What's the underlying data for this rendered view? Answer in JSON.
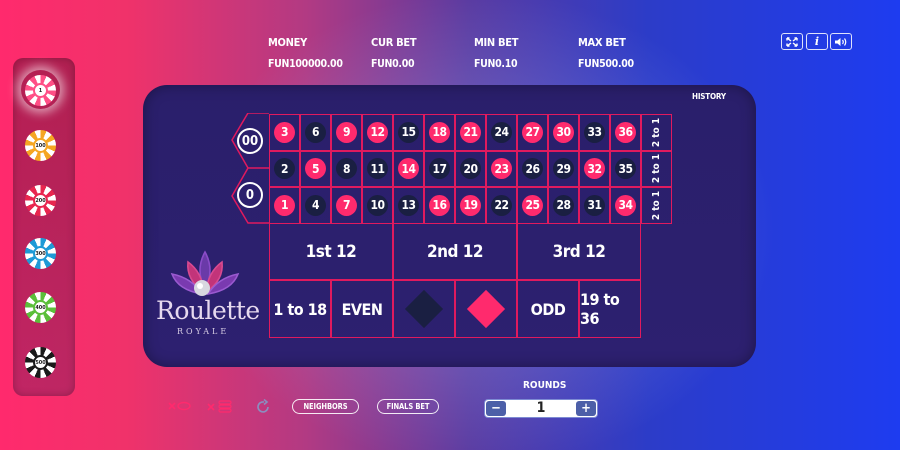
{
  "stats": [
    {
      "label": "MONEY",
      "value": "FUN100000.00"
    },
    {
      "label": "CUR BET",
      "value": "FUN0.00"
    },
    {
      "label": "MIN BET",
      "value": "FUN0.10"
    },
    {
      "label": "MAX BET",
      "value": "FUN500.00"
    }
  ],
  "top_buttons": {
    "fullscreen_icon": "fullscreen-icon",
    "info_label": "i",
    "sound_icon": "speaker-icon"
  },
  "chips": [
    {
      "value": "1",
      "color": "#ff4f86",
      "selected": true
    },
    {
      "value": "100",
      "color": "#f5a623"
    },
    {
      "value": "200",
      "color": "#e8264f"
    },
    {
      "value": "300",
      "color": "#1e9ad6"
    },
    {
      "value": "400",
      "color": "#5bbf3a"
    },
    {
      "value": "500",
      "color": "#1a1a1a"
    }
  ],
  "history_label": "HISTORY",
  "zeros": [
    "00",
    "0"
  ],
  "number_rows": [
    [
      {
        "n": "3",
        "c": "red"
      },
      {
        "n": "6",
        "c": "black"
      },
      {
        "n": "9",
        "c": "red"
      },
      {
        "n": "12",
        "c": "red"
      },
      {
        "n": "15",
        "c": "black"
      },
      {
        "n": "18",
        "c": "red"
      },
      {
        "n": "21",
        "c": "red"
      },
      {
        "n": "24",
        "c": "black"
      },
      {
        "n": "27",
        "c": "red"
      },
      {
        "n": "30",
        "c": "red"
      },
      {
        "n": "33",
        "c": "black"
      },
      {
        "n": "36",
        "c": "red"
      }
    ],
    [
      {
        "n": "2",
        "c": "black"
      },
      {
        "n": "5",
        "c": "red"
      },
      {
        "n": "8",
        "c": "black"
      },
      {
        "n": "11",
        "c": "black"
      },
      {
        "n": "14",
        "c": "red"
      },
      {
        "n": "17",
        "c": "black"
      },
      {
        "n": "20",
        "c": "black"
      },
      {
        "n": "23",
        "c": "red"
      },
      {
        "n": "26",
        "c": "black"
      },
      {
        "n": "29",
        "c": "black"
      },
      {
        "n": "32",
        "c": "red"
      },
      {
        "n": "35",
        "c": "black"
      }
    ],
    [
      {
        "n": "1",
        "c": "red"
      },
      {
        "n": "4",
        "c": "black"
      },
      {
        "n": "7",
        "c": "red"
      },
      {
        "n": "10",
        "c": "black"
      },
      {
        "n": "13",
        "c": "black"
      },
      {
        "n": "16",
        "c": "red"
      },
      {
        "n": "19",
        "c": "red"
      },
      {
        "n": "22",
        "c": "black"
      },
      {
        "n": "25",
        "c": "red"
      },
      {
        "n": "28",
        "c": "black"
      },
      {
        "n": "31",
        "c": "black"
      },
      {
        "n": "34",
        "c": "red"
      }
    ]
  ],
  "columns": [
    "2 to 1",
    "2 to 1",
    "2 to 1"
  ],
  "dozens": [
    "1st 12",
    "2nd 12",
    "3rd 12"
  ],
  "outside": {
    "low": "1 to 18",
    "even": "EVEN",
    "odd": "ODD",
    "high": "19 to 36"
  },
  "colors": {
    "red": "#ff2a6d",
    "black": "#1a1f42",
    "line": "#e01a5e"
  },
  "logo": {
    "title": "Roulette",
    "subtitle": "ROYALE"
  },
  "bottom": {
    "clear_bets_icon": "clear-bets-icon",
    "clear_all_icon": "clear-all-icon",
    "undo_icon": "undo-icon",
    "neighbors": "NEIGHBORS",
    "finals": "FINALS BET",
    "rounds_label": "ROUNDS",
    "rounds_value": "1",
    "minus": "−",
    "plus": "+"
  }
}
